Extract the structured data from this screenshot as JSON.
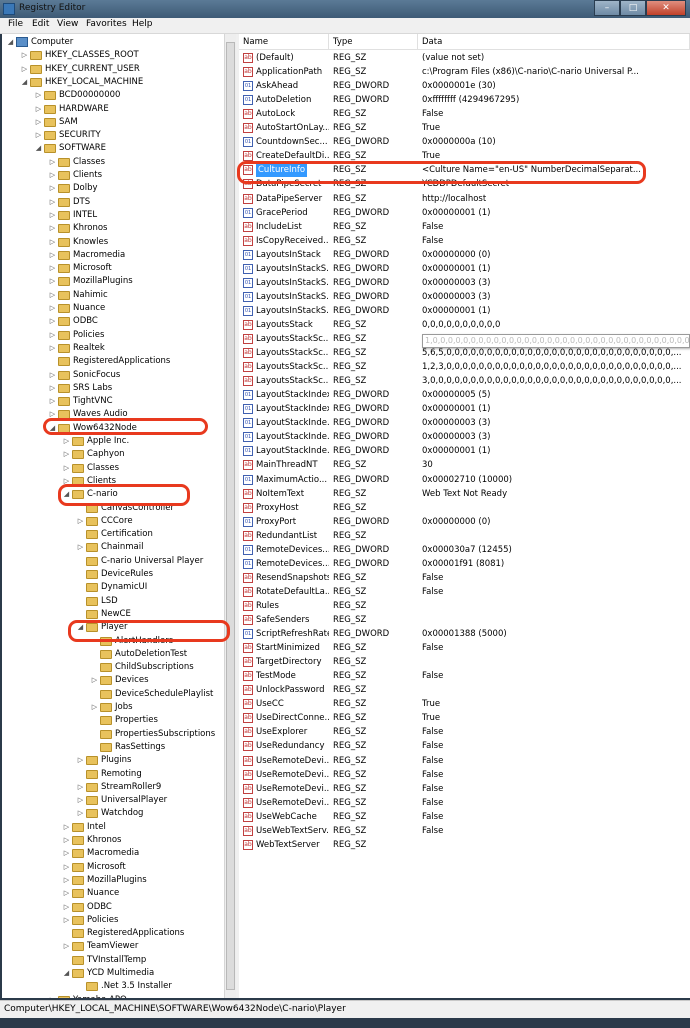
{
  "window": {
    "title": "Registry Editor",
    "minimize": "–",
    "maximize": "□",
    "close": "✕"
  },
  "menu": [
    "File",
    "Edit",
    "View",
    "Favorites",
    "Help"
  ],
  "tree": [
    {
      "label": "Computer",
      "level": 0,
      "type": "computer",
      "exp": "◢"
    },
    {
      "label": "HKEY_CLASSES_ROOT",
      "level": 1,
      "exp": "▷"
    },
    {
      "label": "HKEY_CURRENT_USER",
      "level": 1,
      "exp": "▷"
    },
    {
      "label": "HKEY_LOCAL_MACHINE",
      "level": 1,
      "exp": "◢"
    },
    {
      "label": "BCD00000000",
      "level": 2,
      "exp": "▷"
    },
    {
      "label": "HARDWARE",
      "level": 2,
      "exp": "▷"
    },
    {
      "label": "SAM",
      "level": 2,
      "exp": "▷"
    },
    {
      "label": "SECURITY",
      "level": 2,
      "exp": "▷"
    },
    {
      "label": "SOFTWARE",
      "level": 2,
      "exp": "◢"
    },
    {
      "label": "Classes",
      "level": 3,
      "exp": "▷"
    },
    {
      "label": "Clients",
      "level": 3,
      "exp": "▷"
    },
    {
      "label": "Dolby",
      "level": 3,
      "exp": "▷"
    },
    {
      "label": "DTS",
      "level": 3,
      "exp": "▷"
    },
    {
      "label": "INTEL",
      "level": 3,
      "exp": "▷"
    },
    {
      "label": "Khronos",
      "level": 3,
      "exp": "▷"
    },
    {
      "label": "Knowles",
      "level": 3,
      "exp": "▷"
    },
    {
      "label": "Macromedia",
      "level": 3,
      "exp": "▷"
    },
    {
      "label": "Microsoft",
      "level": 3,
      "exp": "▷"
    },
    {
      "label": "MozillaPlugins",
      "level": 3,
      "exp": "▷"
    },
    {
      "label": "Nahimic",
      "level": 3,
      "exp": "▷"
    },
    {
      "label": "Nuance",
      "level": 3,
      "exp": "▷"
    },
    {
      "label": "ODBC",
      "level": 3,
      "exp": "▷"
    },
    {
      "label": "Policies",
      "level": 3,
      "exp": "▷"
    },
    {
      "label": "Realtek",
      "level": 3,
      "exp": "▷"
    },
    {
      "label": "RegisteredApplications",
      "level": 3,
      "exp": ""
    },
    {
      "label": "SonicFocus",
      "level": 3,
      "exp": "▷"
    },
    {
      "label": "SRS Labs",
      "level": 3,
      "exp": "▷"
    },
    {
      "label": "TightVNC",
      "level": 3,
      "exp": "▷"
    },
    {
      "label": "Waves Audio",
      "level": 3,
      "exp": "▷"
    },
    {
      "label": "Wow6432Node",
      "level": 3,
      "exp": "◢"
    },
    {
      "label": "Apple Inc.",
      "level": 4,
      "exp": "▷"
    },
    {
      "label": "Caphyon",
      "level": 4,
      "exp": "▷"
    },
    {
      "label": "Classes",
      "level": 4,
      "exp": "▷"
    },
    {
      "label": "Clients",
      "level": 4,
      "exp": "▷"
    },
    {
      "label": "C-nario",
      "level": 4,
      "exp": "◢"
    },
    {
      "label": "CanvasController",
      "level": 5,
      "exp": ""
    },
    {
      "label": "CCCore",
      "level": 5,
      "exp": "▷"
    },
    {
      "label": "Certification",
      "level": 5,
      "exp": ""
    },
    {
      "label": "Chainmail",
      "level": 5,
      "exp": "▷"
    },
    {
      "label": "C-nario Universal Player",
      "level": 5,
      "exp": ""
    },
    {
      "label": "DeviceRules",
      "level": 5,
      "exp": ""
    },
    {
      "label": "DynamicUI",
      "level": 5,
      "exp": ""
    },
    {
      "label": "LSD",
      "level": 5,
      "exp": ""
    },
    {
      "label": "NewCE",
      "level": 5,
      "exp": ""
    },
    {
      "label": "Player",
      "level": 5,
      "exp": "◢"
    },
    {
      "label": "AlertHandlers",
      "level": 6,
      "exp": ""
    },
    {
      "label": "AutoDeletionTest",
      "level": 6,
      "exp": ""
    },
    {
      "label": "ChildSubscriptions",
      "level": 6,
      "exp": ""
    },
    {
      "label": "Devices",
      "level": 6,
      "exp": "▷"
    },
    {
      "label": "DeviceSchedulePlaylist",
      "level": 6,
      "exp": ""
    },
    {
      "label": "Jobs",
      "level": 6,
      "exp": "▷"
    },
    {
      "label": "Properties",
      "level": 6,
      "exp": ""
    },
    {
      "label": "PropertiesSubscriptions",
      "level": 6,
      "exp": ""
    },
    {
      "label": "RasSettings",
      "level": 6,
      "exp": ""
    },
    {
      "label": "Plugins",
      "level": 5,
      "exp": "▷"
    },
    {
      "label": "Remoting",
      "level": 5,
      "exp": ""
    },
    {
      "label": "StreamRoller9",
      "level": 5,
      "exp": "▷"
    },
    {
      "label": "UniversalPlayer",
      "level": 5,
      "exp": "▷"
    },
    {
      "label": "Watchdog",
      "level": 5,
      "exp": "▷"
    },
    {
      "label": "Intel",
      "level": 4,
      "exp": "▷"
    },
    {
      "label": "Khronos",
      "level": 4,
      "exp": "▷"
    },
    {
      "label": "Macromedia",
      "level": 4,
      "exp": "▷"
    },
    {
      "label": "Microsoft",
      "level": 4,
      "exp": "▷"
    },
    {
      "label": "MozillaPlugins",
      "level": 4,
      "exp": "▷"
    },
    {
      "label": "Nuance",
      "level": 4,
      "exp": "▷"
    },
    {
      "label": "ODBC",
      "level": 4,
      "exp": "▷"
    },
    {
      "label": "Policies",
      "level": 4,
      "exp": "▷"
    },
    {
      "label": "RegisteredApplications",
      "level": 4,
      "exp": ""
    },
    {
      "label": "TeamViewer",
      "level": 4,
      "exp": "▷"
    },
    {
      "label": "TVInstallTemp",
      "level": 4,
      "exp": ""
    },
    {
      "label": "YCD Multimedia",
      "level": 4,
      "exp": "◢"
    },
    {
      "label": ".Net 3.5 Installer",
      "level": 5,
      "exp": ""
    },
    {
      "label": "Yamaha APO",
      "level": 3,
      "exp": "▷"
    }
  ],
  "columns": {
    "name": "Name",
    "type": "Type",
    "data": "Data"
  },
  "values": [
    {
      "name": "(Default)",
      "type": "REG_SZ",
      "data": "(value not set)",
      "kind": "sz"
    },
    {
      "name": "ApplicationPath",
      "type": "REG_SZ",
      "data": "c:\\Program Files (x86)\\C-nario\\C-nario Universal P...",
      "kind": "sz"
    },
    {
      "name": "AskAhead",
      "type": "REG_DWORD",
      "data": "0x0000001e (30)",
      "kind": "bin"
    },
    {
      "name": "AutoDeletion",
      "type": "REG_DWORD",
      "data": "0xffffffff (4294967295)",
      "kind": "bin"
    },
    {
      "name": "AutoLock",
      "type": "REG_SZ",
      "data": "False",
      "kind": "sz"
    },
    {
      "name": "AutoStartOnLay...",
      "type": "REG_SZ",
      "data": "True",
      "kind": "sz"
    },
    {
      "name": "CountdownSec...",
      "type": "REG_DWORD",
      "data": "0x0000000a (10)",
      "kind": "bin"
    },
    {
      "name": "CreateDefaultDi...",
      "type": "REG_SZ",
      "data": "True",
      "kind": "sz"
    },
    {
      "name": "CultureInfo",
      "type": "REG_SZ",
      "data": "<Culture Name=\"en-US\" NumberDecimalSeparat...",
      "kind": "sz",
      "selected": true
    },
    {
      "name": "DataPipeSecret",
      "type": "REG_SZ",
      "data": "YCDDPDefaultSecret",
      "kind": "sz"
    },
    {
      "name": "DataPipeServer",
      "type": "REG_SZ",
      "data": "http://localhost",
      "kind": "sz"
    },
    {
      "name": "GracePeriod",
      "type": "REG_DWORD",
      "data": "0x00000001 (1)",
      "kind": "bin"
    },
    {
      "name": "IncludeList",
      "type": "REG_SZ",
      "data": "False",
      "kind": "sz"
    },
    {
      "name": "IsCopyReceived...",
      "type": "REG_SZ",
      "data": "False",
      "kind": "sz"
    },
    {
      "name": "LayoutsInStack",
      "type": "REG_DWORD",
      "data": "0x00000000 (0)",
      "kind": "bin"
    },
    {
      "name": "LayoutsInStackS...",
      "type": "REG_DWORD",
      "data": "0x00000001 (1)",
      "kind": "bin"
    },
    {
      "name": "LayoutsInStackS...",
      "type": "REG_DWORD",
      "data": "0x00000003 (3)",
      "kind": "bin"
    },
    {
      "name": "LayoutsInStackS...",
      "type": "REG_DWORD",
      "data": "0x00000003 (3)",
      "kind": "bin"
    },
    {
      "name": "LayoutsInStackS...",
      "type": "REG_DWORD",
      "data": "0x00000001 (1)",
      "kind": "bin"
    },
    {
      "name": "LayoutsStack",
      "type": "REG_SZ",
      "data": "0,0,0,0,0,0,0,0,0,0",
      "kind": "sz"
    },
    {
      "name": "LayoutsStackSc...",
      "type": "REG_SZ",
      "data": "1,0,0,0,0,0,0,0,0,0,0,0,0,0,0,0,0,0,0,0,0,0,0,0,0,0,0,0,0,0,0,...",
      "kind": "sz"
    },
    {
      "name": "LayoutsStackSc...",
      "type": "REG_SZ",
      "data": "5,6,5,0,0,0,0,0,0,0,0,0,0,0,0,0,0,0,0,0,0,0,0,0,0,0,0,0,0,0,0,...",
      "kind": "sz"
    },
    {
      "name": "LayoutsStackSc...",
      "type": "REG_SZ",
      "data": "1,2,3,0,0,0,0,0,0,0,0,0,0,0,0,0,0,0,0,0,0,0,0,0,0,0,0,0,0,0,0,...",
      "kind": "sz"
    },
    {
      "name": "LayoutsStackSc...",
      "type": "REG_SZ",
      "data": "3,0,0,0,0,0,0,0,0,0,0,0,0,0,0,0,0,0,0,0,0,0,0,0,0,0,0,0,0,0,0,...",
      "kind": "sz"
    },
    {
      "name": "LayoutStackIndex",
      "type": "REG_DWORD",
      "data": "0x00000005 (5)",
      "kind": "bin"
    },
    {
      "name": "LayoutStackIndex",
      "type": "REG_DWORD",
      "data": "0x00000001 (1)",
      "kind": "bin"
    },
    {
      "name": "LayoutStackInde...",
      "type": "REG_DWORD",
      "data": "0x00000003 (3)",
      "kind": "bin"
    },
    {
      "name": "LayoutStackInde...",
      "type": "REG_DWORD",
      "data": "0x00000003 (3)",
      "kind": "bin"
    },
    {
      "name": "LayoutStackInde...",
      "type": "REG_DWORD",
      "data": "0x00000001 (1)",
      "kind": "bin"
    },
    {
      "name": "MainThreadNT",
      "type": "REG_SZ",
      "data": "30",
      "kind": "sz"
    },
    {
      "name": "MaximumActio...",
      "type": "REG_DWORD",
      "data": "0x00002710 (10000)",
      "kind": "bin"
    },
    {
      "name": "NoItemText",
      "type": "REG_SZ",
      "data": "Web Text Not Ready",
      "kind": "sz"
    },
    {
      "name": "ProxyHost",
      "type": "REG_SZ",
      "data": "",
      "kind": "sz"
    },
    {
      "name": "ProxyPort",
      "type": "REG_DWORD",
      "data": "0x00000000 (0)",
      "kind": "bin"
    },
    {
      "name": "RedundantList",
      "type": "REG_SZ",
      "data": "",
      "kind": "sz"
    },
    {
      "name": "RemoteDevices...",
      "type": "REG_DWORD",
      "data": "0x000030a7 (12455)",
      "kind": "bin"
    },
    {
      "name": "RemoteDevices...",
      "type": "REG_DWORD",
      "data": "0x00001f91 (8081)",
      "kind": "bin"
    },
    {
      "name": "ResendSnapshots",
      "type": "REG_SZ",
      "data": "False",
      "kind": "sz"
    },
    {
      "name": "RotateDefaultLa...",
      "type": "REG_SZ",
      "data": "False",
      "kind": "sz"
    },
    {
      "name": "Rules",
      "type": "REG_SZ",
      "data": "",
      "kind": "sz"
    },
    {
      "name": "SafeSenders",
      "type": "REG_SZ",
      "data": "",
      "kind": "sz"
    },
    {
      "name": "ScriptRefreshRate",
      "type": "REG_DWORD",
      "data": "0x00001388 (5000)",
      "kind": "bin"
    },
    {
      "name": "StartMinimized",
      "type": "REG_SZ",
      "data": "False",
      "kind": "sz"
    },
    {
      "name": "TargetDirectory",
      "type": "REG_SZ",
      "data": "",
      "kind": "sz"
    },
    {
      "name": "TestMode",
      "type": "REG_SZ",
      "data": "False",
      "kind": "sz"
    },
    {
      "name": "UnlockPassword",
      "type": "REG_SZ",
      "data": "",
      "kind": "sz"
    },
    {
      "name": "UseCC",
      "type": "REG_SZ",
      "data": "True",
      "kind": "sz"
    },
    {
      "name": "UseDirectConne...",
      "type": "REG_SZ",
      "data": "True",
      "kind": "sz"
    },
    {
      "name": "UseExplorer",
      "type": "REG_SZ",
      "data": "False",
      "kind": "sz"
    },
    {
      "name": "UseRedundancy",
      "type": "REG_SZ",
      "data": "False",
      "kind": "sz"
    },
    {
      "name": "UseRemoteDevi...",
      "type": "REG_SZ",
      "data": "False",
      "kind": "sz"
    },
    {
      "name": "UseRemoteDevi...",
      "type": "REG_SZ",
      "data": "False",
      "kind": "sz"
    },
    {
      "name": "UseRemoteDevi...",
      "type": "REG_SZ",
      "data": "False",
      "kind": "sz"
    },
    {
      "name": "UseRemoteDevi...",
      "type": "REG_SZ",
      "data": "False",
      "kind": "sz"
    },
    {
      "name": "UseWebCache",
      "type": "REG_SZ",
      "data": "False",
      "kind": "sz"
    },
    {
      "name": "UseWebTextServ...",
      "type": "REG_SZ",
      "data": "False",
      "kind": "sz"
    },
    {
      "name": "WebTextServer",
      "type": "REG_SZ",
      "data": "",
      "kind": "sz"
    }
  ],
  "tooltip": "1,0,0,0,0,0,0,0,0,0,0,0,0,0,0,0,0,0,0,0,0,0,0,0,0,0,0,0,0,0,0,0,0,0,0,0,0,0,0,0",
  "status": "Computer\\HKEY_LOCAL_MACHINE\\SOFTWARE\\Wow6432Node\\C-nario\\Player",
  "highlight_color": "#e8391e"
}
